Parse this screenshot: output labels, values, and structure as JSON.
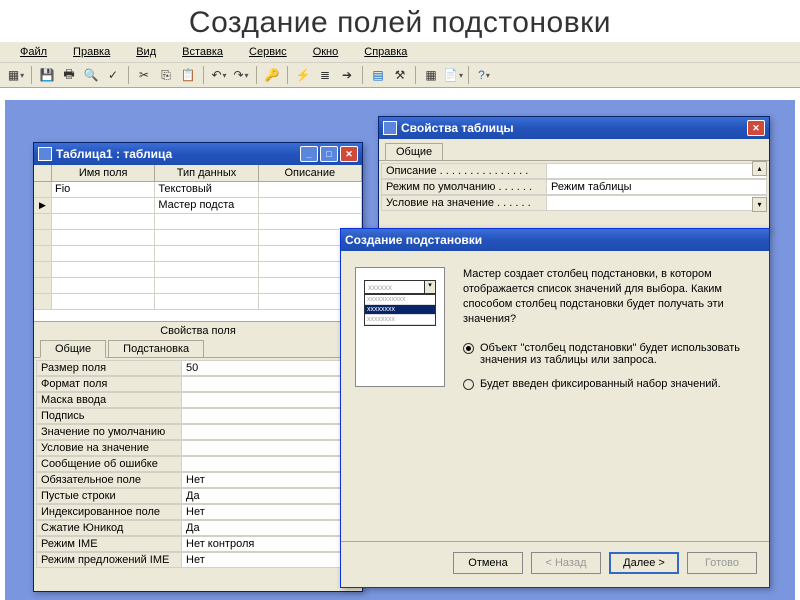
{
  "slide_title": "Создание полей подстоновки",
  "menu": {
    "file": "Файл",
    "edit": "Правка",
    "view": "Вид",
    "insert": "Вставка",
    "service": "Сервис",
    "window": "Окно",
    "help": "Справка"
  },
  "toolbar_icons": {
    "view": "▦",
    "save": "💾",
    "print": "🖶",
    "preview": "🔍",
    "spell": "✓",
    "cut": "✂",
    "copy": "⎘",
    "paste": "📋",
    "undo": "↶",
    "redo": "↷",
    "key": "🔑",
    "lightning": "⚡",
    "rows": "≣",
    "insert_row": "➔",
    "props": "▤",
    "build": "⚒",
    "db": "▦",
    "newobj": "📄",
    "help": "?"
  },
  "table_window": {
    "title": "Таблица1 : таблица",
    "columns": {
      "name": "Имя поля",
      "type": "Тип данных",
      "desc": "Описание"
    },
    "rows": [
      {
        "name": "Fio",
        "type": "Текстовый",
        "desc": ""
      },
      {
        "name": "",
        "type": "Мастер подста",
        "desc": ""
      }
    ],
    "field_props_header": "Свойства поля",
    "tabs": {
      "general": "Общие",
      "lookup": "Подстановка"
    },
    "props": [
      {
        "label": "Размер поля",
        "value": "50"
      },
      {
        "label": "Формат поля",
        "value": ""
      },
      {
        "label": "Маска ввода",
        "value": ""
      },
      {
        "label": "Подпись",
        "value": ""
      },
      {
        "label": "Значение по умолчанию",
        "value": ""
      },
      {
        "label": "Условие на значение",
        "value": ""
      },
      {
        "label": "Сообщение об ошибке",
        "value": ""
      },
      {
        "label": "Обязательное поле",
        "value": "Нет"
      },
      {
        "label": "Пустые строки",
        "value": "Да"
      },
      {
        "label": "Индексированное поле",
        "value": "Нет"
      },
      {
        "label": "Сжатие Юникод",
        "value": "Да"
      },
      {
        "label": "Режим IME",
        "value": "Нет контроля"
      },
      {
        "label": "Режим предложений IME",
        "value": "Нет"
      }
    ]
  },
  "props_window": {
    "title": "Свойства таблицы",
    "tab": "Общие",
    "rows": [
      {
        "label": "Описание . . . . . . . . . . . . . . .",
        "value": ""
      },
      {
        "label": "Режим по умолчанию . . . . . .",
        "value": "Режим таблицы"
      },
      {
        "label": "Условие на значение . . . . . .",
        "value": ""
      }
    ]
  },
  "wizard": {
    "title": "Создание подстановки",
    "question": "Мастер создает столбец подстановки, в котором отображается список значений для выбора. Каким способом столбец подстановки будет получать эти значения?",
    "opt1": "Объект \"столбец подстановки\" будет использовать значения из таблицы или запроса.",
    "opt2": "Будет введен фиксированный набор значений.",
    "buttons": {
      "cancel": "Отмена",
      "back": "< Назад",
      "next": "Далее >",
      "finish": "Готово"
    },
    "preview_items": [
      "xxxxxxxxxxx",
      "xxxxxxxx",
      "xxxxxxxx"
    ]
  }
}
